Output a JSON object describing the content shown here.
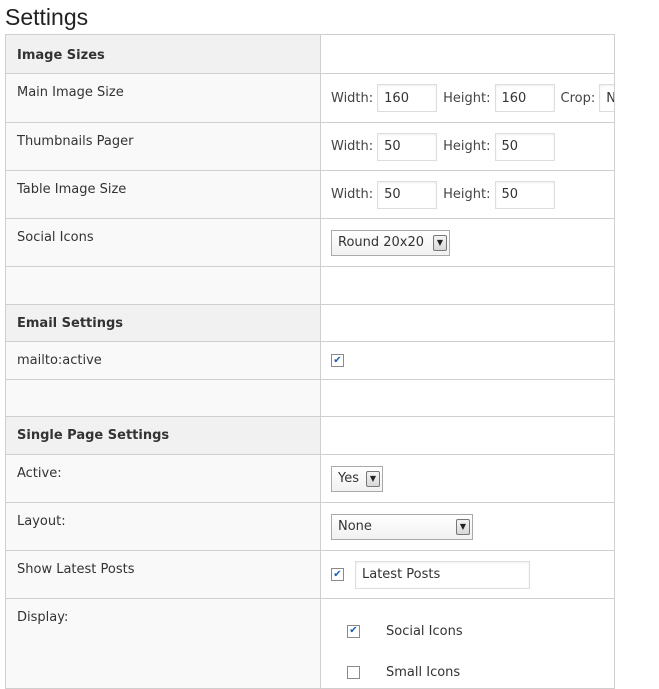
{
  "page": {
    "title": "Settings"
  },
  "sections": {
    "image_sizes": "Image Sizes",
    "email_settings": "Email Settings",
    "single_page_settings": "Single Page Settings"
  },
  "rows": {
    "main_image_size": {
      "label": "Main Image Size",
      "width_label": "Width:",
      "width_value": "160",
      "height_label": "Height:",
      "height_value": "160",
      "crop_label": "Crop:",
      "crop_value": "No"
    },
    "thumbnails_pager": {
      "label": "Thumbnails Pager",
      "width_label": "Width:",
      "width_value": "50",
      "height_label": "Height:",
      "height_value": "50"
    },
    "table_image_size": {
      "label": "Table Image Size",
      "width_label": "Width:",
      "width_value": "50",
      "height_label": "Height:",
      "height_value": "50"
    },
    "social_icons": {
      "label": "Social Icons",
      "selected": "Round 20x20"
    },
    "mailto_active": {
      "label": "mailto:active",
      "checked": true
    },
    "active": {
      "label": "Active:",
      "selected": "Yes"
    },
    "layout": {
      "label": "Layout:",
      "selected": "None"
    },
    "show_latest_posts": {
      "label": "Show Latest Posts",
      "checked": true,
      "title_value": "Latest Posts"
    },
    "display": {
      "label": "Display:",
      "options": [
        {
          "label": "Social Icons",
          "checked": true
        },
        {
          "label": "Small Icons",
          "checked": false
        }
      ]
    }
  },
  "icons": {
    "check": "✔",
    "dropdown_arrow": "▼"
  },
  "colors": {
    "check_mark": "#1c5fb0",
    "section_bg": "#f1f1f1",
    "border": "#cfcfcf"
  }
}
